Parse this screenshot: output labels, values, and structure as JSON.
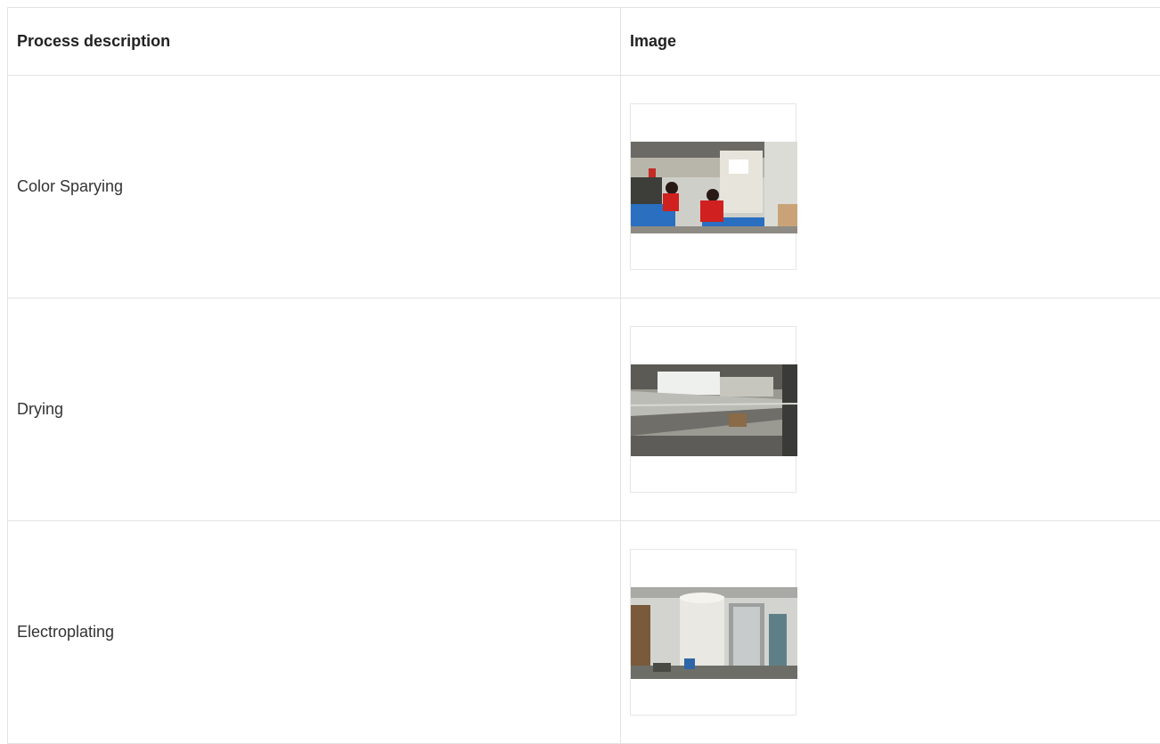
{
  "table": {
    "headers": {
      "description": "Process description",
      "image": "Image"
    },
    "rows": [
      {
        "description": "Color Sparying",
        "image_icon": "factory-spraying-photo"
      },
      {
        "description": "Drying",
        "image_icon": "factory-drying-line-photo"
      },
      {
        "description": "Electroplating",
        "image_icon": "electroplating-machine-photo"
      }
    ]
  }
}
